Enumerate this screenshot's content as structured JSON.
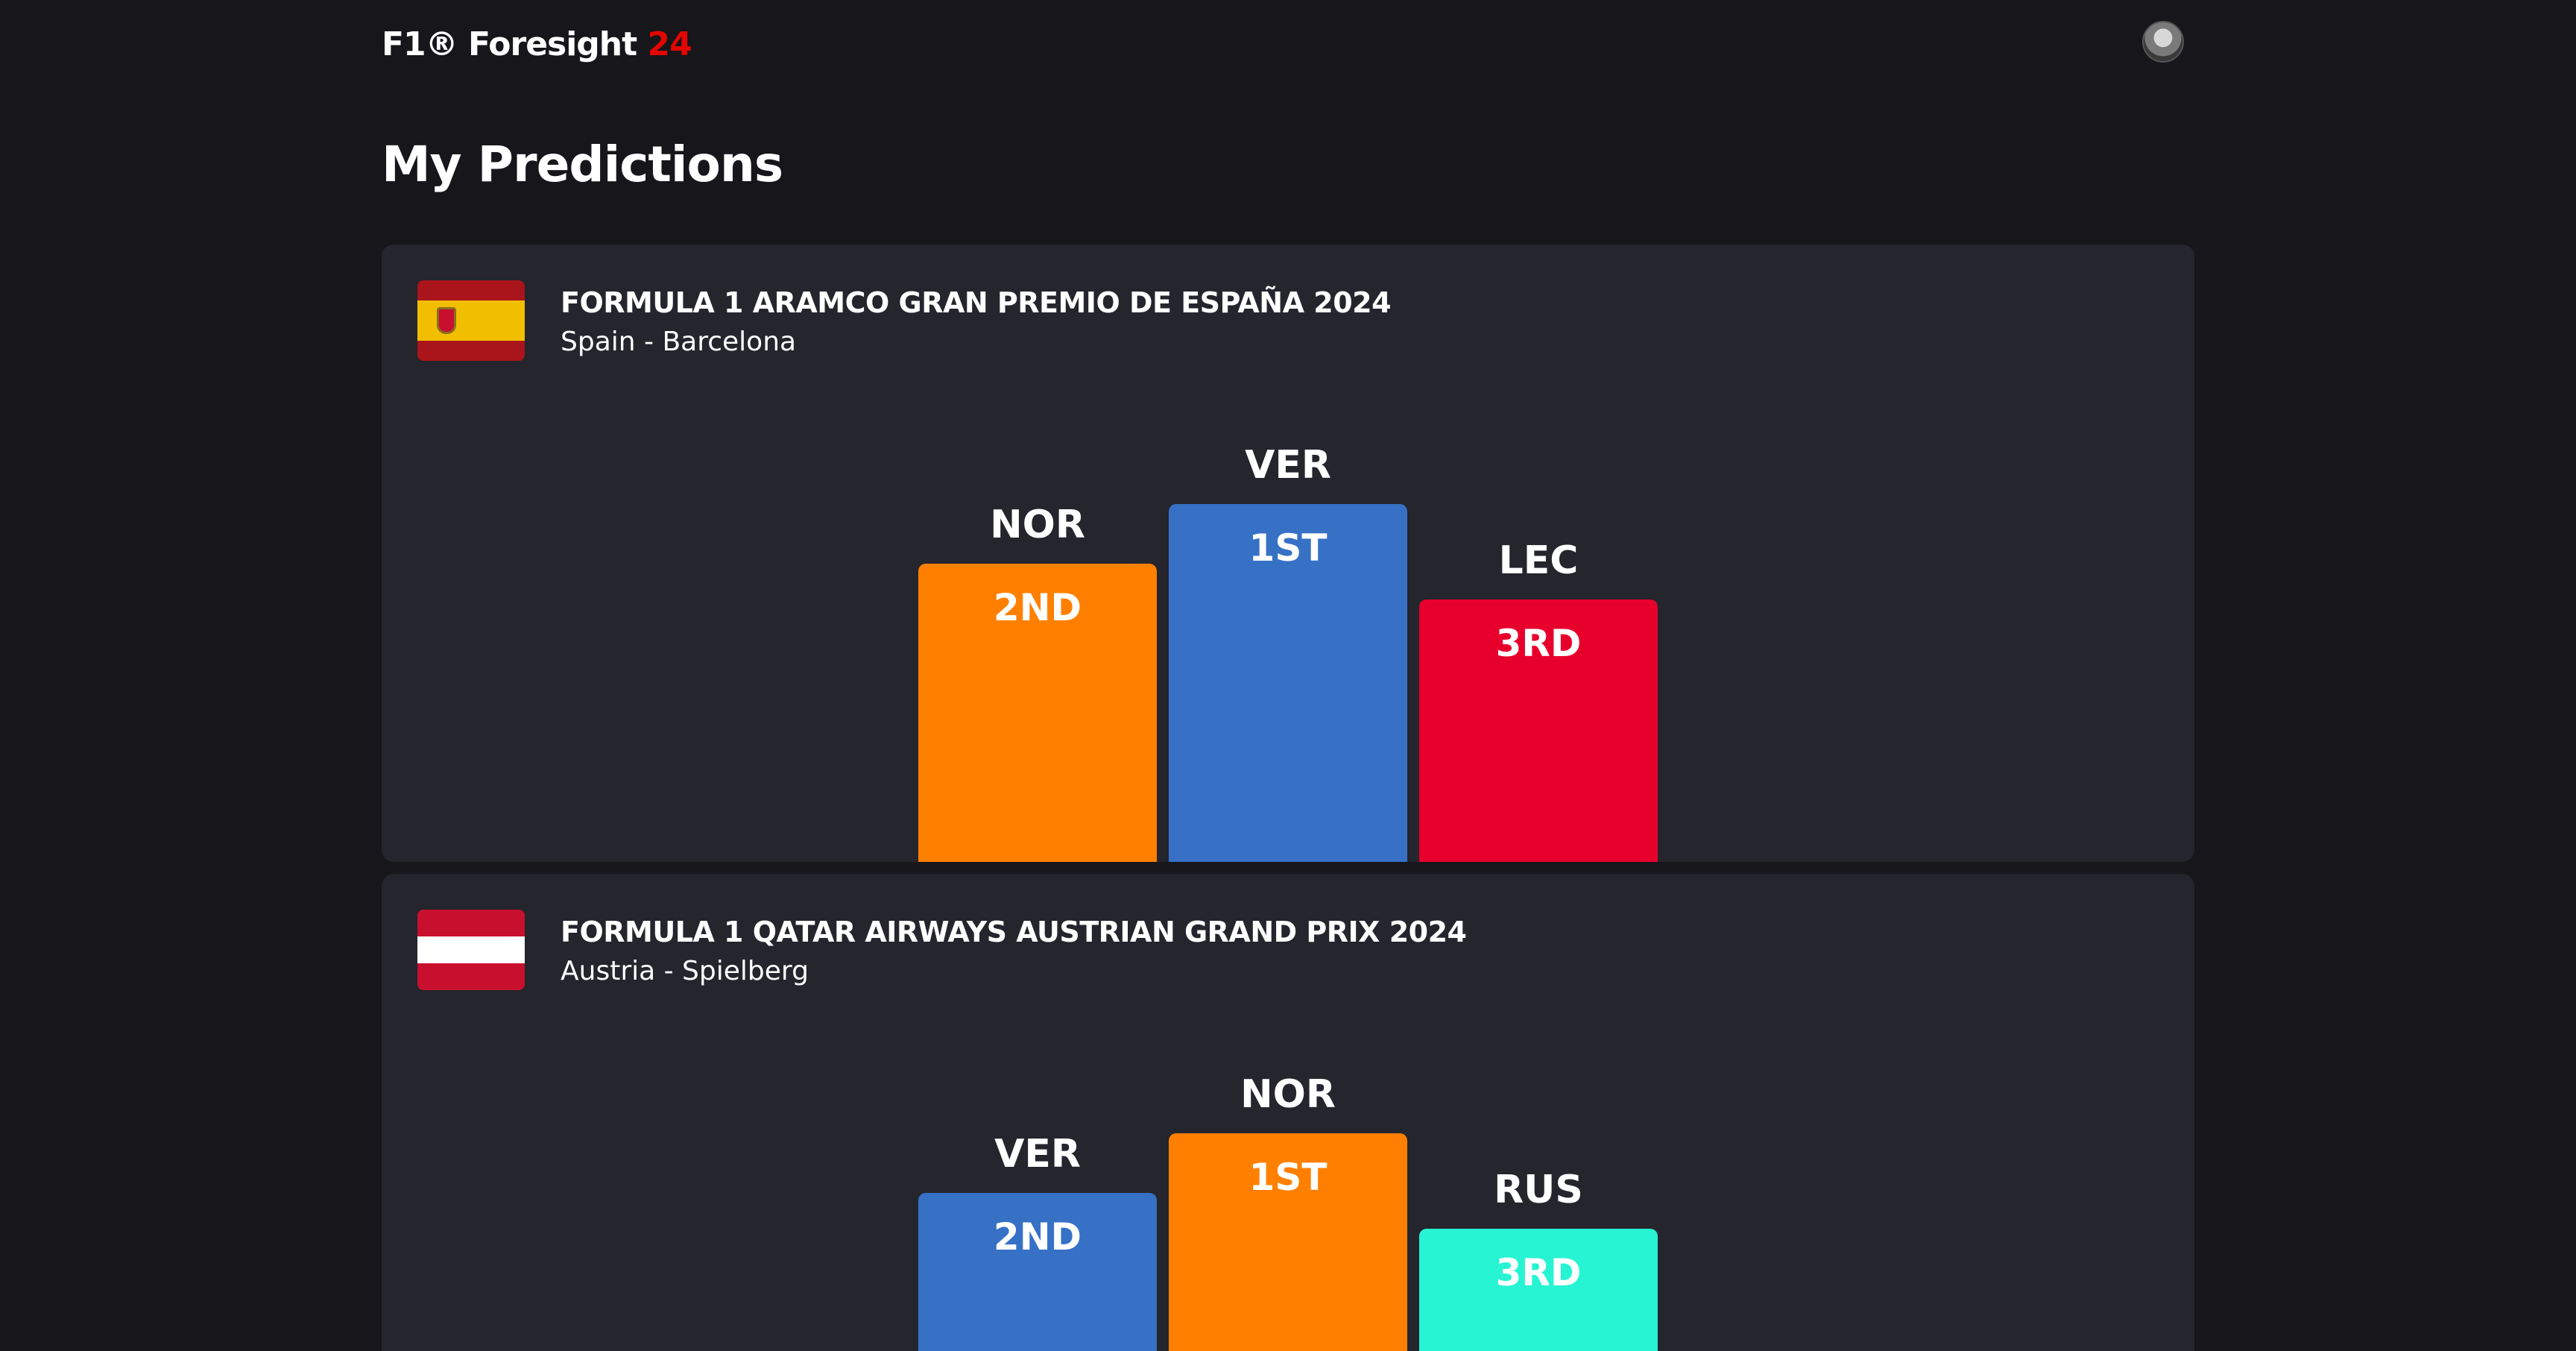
{
  "header": {
    "brand_main": "F1® Foresight ",
    "brand_accent": "24"
  },
  "page": {
    "title": "My Predictions"
  },
  "predictions": [
    {
      "title": "FORMULA 1 ARAMCO GRAN PREMIO DE ESPAÑA 2024",
      "location": "Spain - Barcelona",
      "flag": "spain-flag-icon",
      "podium": {
        "first": {
          "driver": "VER",
          "label": "1ST",
          "color": "#3671c6"
        },
        "second": {
          "driver": "NOR",
          "label": "2ND",
          "color": "#ff8000"
        },
        "third": {
          "driver": "LEC",
          "label": "3RD",
          "color": "#e8002d"
        }
      }
    },
    {
      "title": "FORMULA 1 QATAR AIRWAYS AUSTRIAN GRAND PRIX 2024",
      "location": "Austria - Spielberg",
      "flag": "austria-flag-icon",
      "podium": {
        "first": {
          "driver": "NOR",
          "label": "1ST",
          "color": "#ff8000"
        },
        "second": {
          "driver": "VER",
          "label": "2ND",
          "color": "#3671c6"
        },
        "third": {
          "driver": "RUS",
          "label": "3RD",
          "color": "#27f4d2"
        }
      }
    }
  ]
}
